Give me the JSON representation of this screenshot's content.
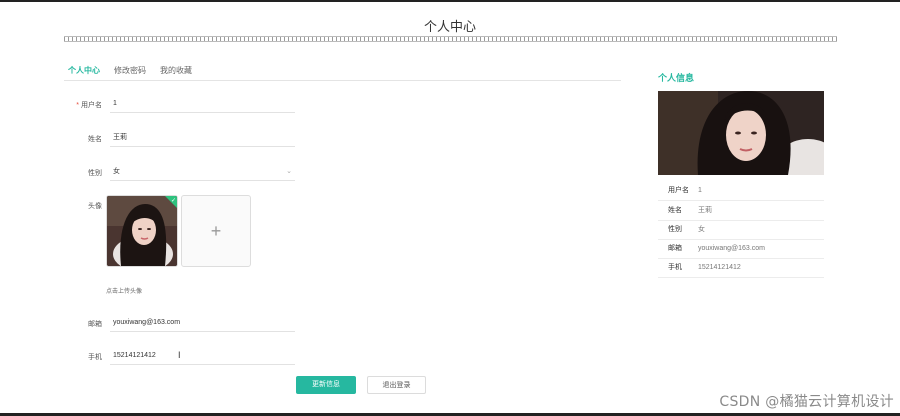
{
  "page_title": "个人中心",
  "tabs": [
    {
      "label": "个人中心",
      "active": true
    },
    {
      "label": "修改密码",
      "active": false
    },
    {
      "label": "我的收藏",
      "active": false
    }
  ],
  "form": {
    "username": {
      "label": "用户名",
      "required": true,
      "value": "1"
    },
    "name": {
      "label": "姓名",
      "value": "王莉"
    },
    "gender": {
      "label": "性别",
      "value": "女"
    },
    "avatar": {
      "label": "头像",
      "hint": "点击上传头像",
      "upload_icon": "+"
    },
    "email": {
      "label": "邮箱",
      "value": "youxiwang@163.com"
    },
    "phone": {
      "label": "手机",
      "value": "15214121412"
    }
  },
  "buttons": {
    "update": "更新信息",
    "logout": "退出登录"
  },
  "sidebar": {
    "title": "个人信息",
    "rows": [
      {
        "key": "用户名",
        "value": "1"
      },
      {
        "key": "姓名",
        "value": "王莉"
      },
      {
        "key": "性别",
        "value": "女"
      },
      {
        "key": "邮箱",
        "value": "youxiwang@163.com"
      },
      {
        "key": "手机",
        "value": "15214121412"
      }
    ]
  },
  "watermark": "CSDN @橘猫云计算机设计",
  "colors": {
    "accent": "#26b8a0",
    "success": "#2ec27e"
  }
}
